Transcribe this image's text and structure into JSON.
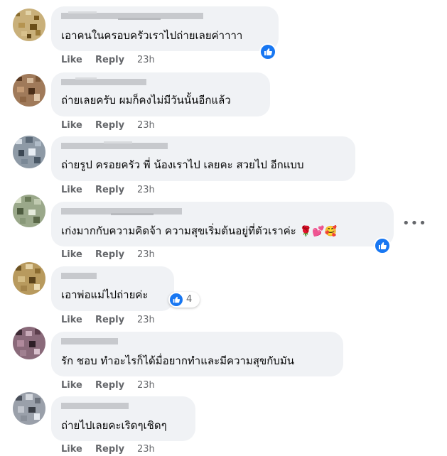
{
  "actions": {
    "like": "Like",
    "reply": "Reply"
  },
  "comments": [
    {
      "text": "เอาคนในครอบครัวเราไปถ่ายเลยค่าาาา",
      "time": "23h"
    },
    {
      "text": "ถ่ายเลยครับ ผมก็คงไม่มีวันนั้นอีกแล้ว",
      "time": "23h"
    },
    {
      "text": "ถ่ายรูป ครอยครัว พี่ น้องเราไป เลยคะ สวยไป อีกแบบ",
      "time": "23h"
    },
    {
      "text": "เก่งมากกับความคิดจ้า ความสุขเริ่มต้นอยู่ที่ตัวเราค่ะ",
      "emojis": "🌹💕🥰",
      "time": "23h"
    },
    {
      "text": "เอาพ่อแม่ไปถ่ายค่ะ",
      "reaction_count": "4",
      "time": "23h"
    },
    {
      "text": "รัก ชอบ ทำอะไรก็ได้มื่อยากทำและมีความสุขกับมัน",
      "time": "23h"
    },
    {
      "text": "ถ่ายไปเลยคะเริดๆเชิดๆ",
      "time": "23h"
    }
  ],
  "more_icon": "•••",
  "colors": {
    "bubble": "#f0f2f5",
    "action_text": "#65676b",
    "like_blue": "#1877f2"
  }
}
